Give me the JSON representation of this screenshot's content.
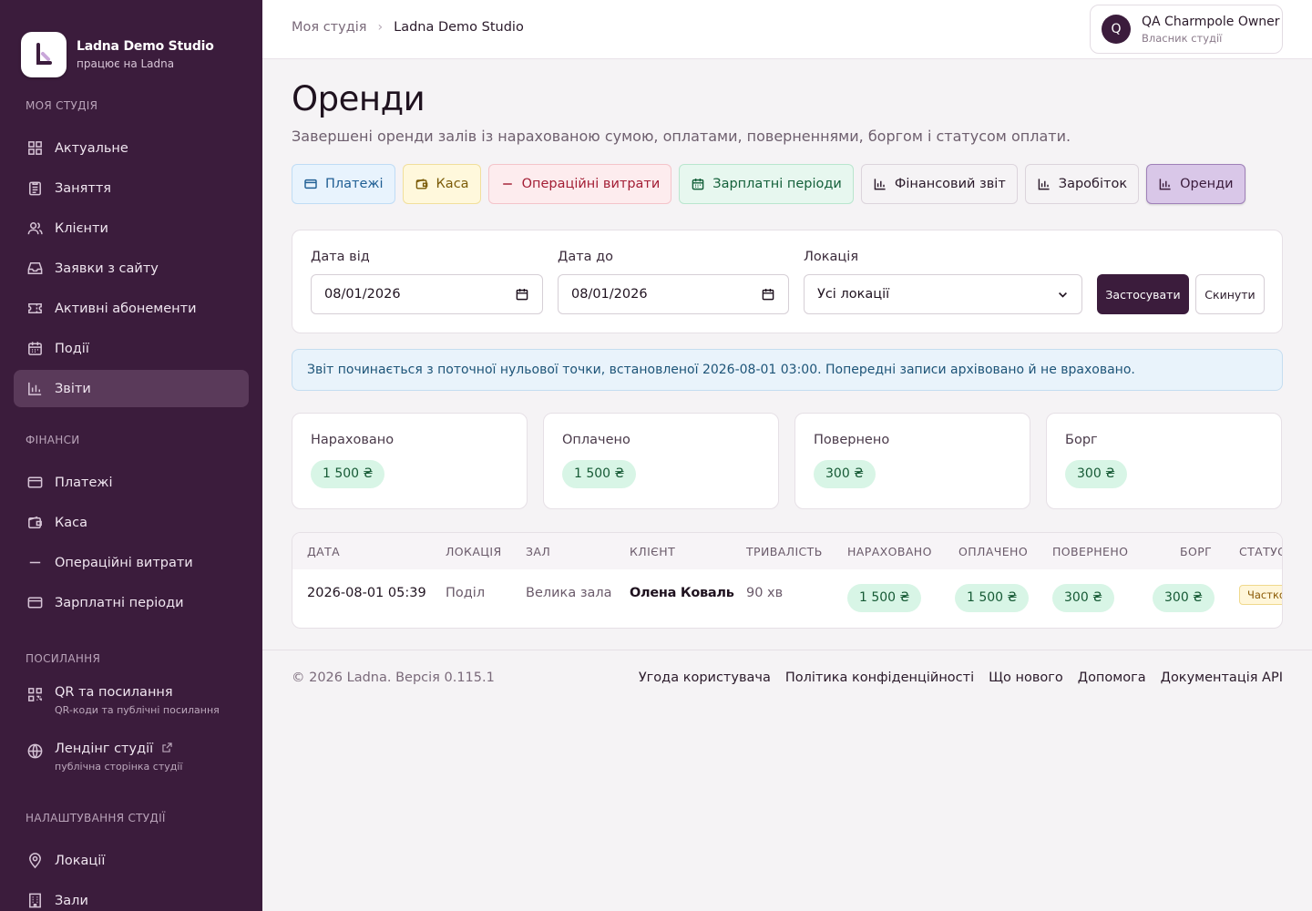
{
  "brand": {
    "name": "Ladna Demo Studio",
    "sub": "працює на Ladna"
  },
  "sidebar": {
    "sections": [
      {
        "label": "Моя студія",
        "items": [
          {
            "label": "Актуальне",
            "icon": "grid-icon"
          },
          {
            "label": "Заняття",
            "icon": "clipboard-icon"
          },
          {
            "label": "Клієнти",
            "icon": "users-icon"
          },
          {
            "label": "Заявки з сайту",
            "icon": "inbox-icon"
          },
          {
            "label": "Активні абонементи",
            "icon": "ticket-icon"
          },
          {
            "label": "Події",
            "icon": "calendar-icon"
          },
          {
            "label": "Звіти",
            "icon": "bar-chart-icon",
            "active": true
          }
        ]
      },
      {
        "label": "Фінанси",
        "items": [
          {
            "label": "Платежі",
            "icon": "credit-card-icon"
          },
          {
            "label": "Каса",
            "icon": "wallet-icon"
          },
          {
            "label": "Операційні витрати",
            "icon": "minus-icon"
          },
          {
            "label": "Зарплатні періоди",
            "icon": "credit-card-icon"
          }
        ]
      },
      {
        "label": "Посилання",
        "items": [
          {
            "label": "QR та посилання",
            "sub": "QR-коди та публічні посилання",
            "icon": "qr-icon"
          },
          {
            "label": "Лендінг студії",
            "sub": "публічна сторінка студії",
            "icon": "globe-icon"
          }
        ]
      },
      {
        "label": "Налаштування студії",
        "items": [
          {
            "label": "Локації",
            "icon": "map-pin-icon"
          },
          {
            "label": "Зали",
            "icon": "building-icon"
          }
        ]
      }
    ]
  },
  "breadcrumb": {
    "first": "Моя студія",
    "separator": "›",
    "last": "Ladna Demo Studio"
  },
  "user": {
    "initial": "Q",
    "name": "QA Charmpole Owner",
    "role": "Власник студії"
  },
  "page": {
    "title": "Оренди",
    "subtitle": "Завершені оренди залів із нарахованою сумою, оплатами, поверненнями, боргом і статусом оплати."
  },
  "tabs": [
    {
      "label": "Платежі",
      "icon": "credit-card-icon"
    },
    {
      "label": "Каса",
      "icon": "wallet-icon"
    },
    {
      "label": "Операційні витрати",
      "icon": "minus-icon"
    },
    {
      "label": "Зарплатні періоди",
      "icon": "calendar-icon"
    },
    {
      "label": "Фінансовий звіт",
      "icon": "bar-chart-icon"
    },
    {
      "label": "Заробіток",
      "icon": "bar-chart-icon"
    },
    {
      "label": "Оренди",
      "icon": "bar-chart-icon",
      "active": true
    }
  ],
  "filters": {
    "date_from_label": "Дата від",
    "date_from_value": "08/01/2026",
    "date_to_label": "Дата до",
    "date_to_value": "08/01/2026",
    "location_label": "Локація",
    "location_value": "Усі локації",
    "apply_label": "Застосувати",
    "reset_label": "Скинути"
  },
  "info": "Звіт починається з поточної нульової точки, встановленої 2026-08-01 03:00. Попередні записи архівовано й не враховано.",
  "stats": [
    {
      "label": "Нараховано",
      "value": "1 500 ₴"
    },
    {
      "label": "Оплачено",
      "value": "1 500 ₴"
    },
    {
      "label": "Повернено",
      "value": "300 ₴"
    },
    {
      "label": "Борг",
      "value": "300 ₴"
    }
  ],
  "table": {
    "headers": [
      "ДАТА",
      "ЛОКАЦІЯ",
      "ЗАЛ",
      "КЛІЄНТ",
      "ТРИВАЛІСТЬ",
      "НАРАХОВАНО",
      "ОПЛАЧЕНО",
      "ПОВЕРНЕНО",
      "БОРГ",
      "СТАТУС"
    ],
    "rows": [
      {
        "date": "2026-08-01 05:39",
        "location": "Поділ",
        "hall": "Велика зала",
        "client": "Олена Коваль",
        "duration": "90 хв",
        "charged": "1 500 ₴",
        "paid": "1 500 ₴",
        "refunded": "300 ₴",
        "debt": "300 ₴",
        "status": "Частково"
      }
    ]
  },
  "footer": {
    "copy": "© 2026 Ladna. Версія 0.115.1",
    "links": [
      "Угода користувача",
      "Політика конфіденційності",
      "Що нового",
      "Допомога",
      "Документація API"
    ]
  },
  "colors": {
    "sidebar": "#3b1c3c",
    "accent": "#3b1c3c",
    "success_pill": "#d8f5e6"
  }
}
